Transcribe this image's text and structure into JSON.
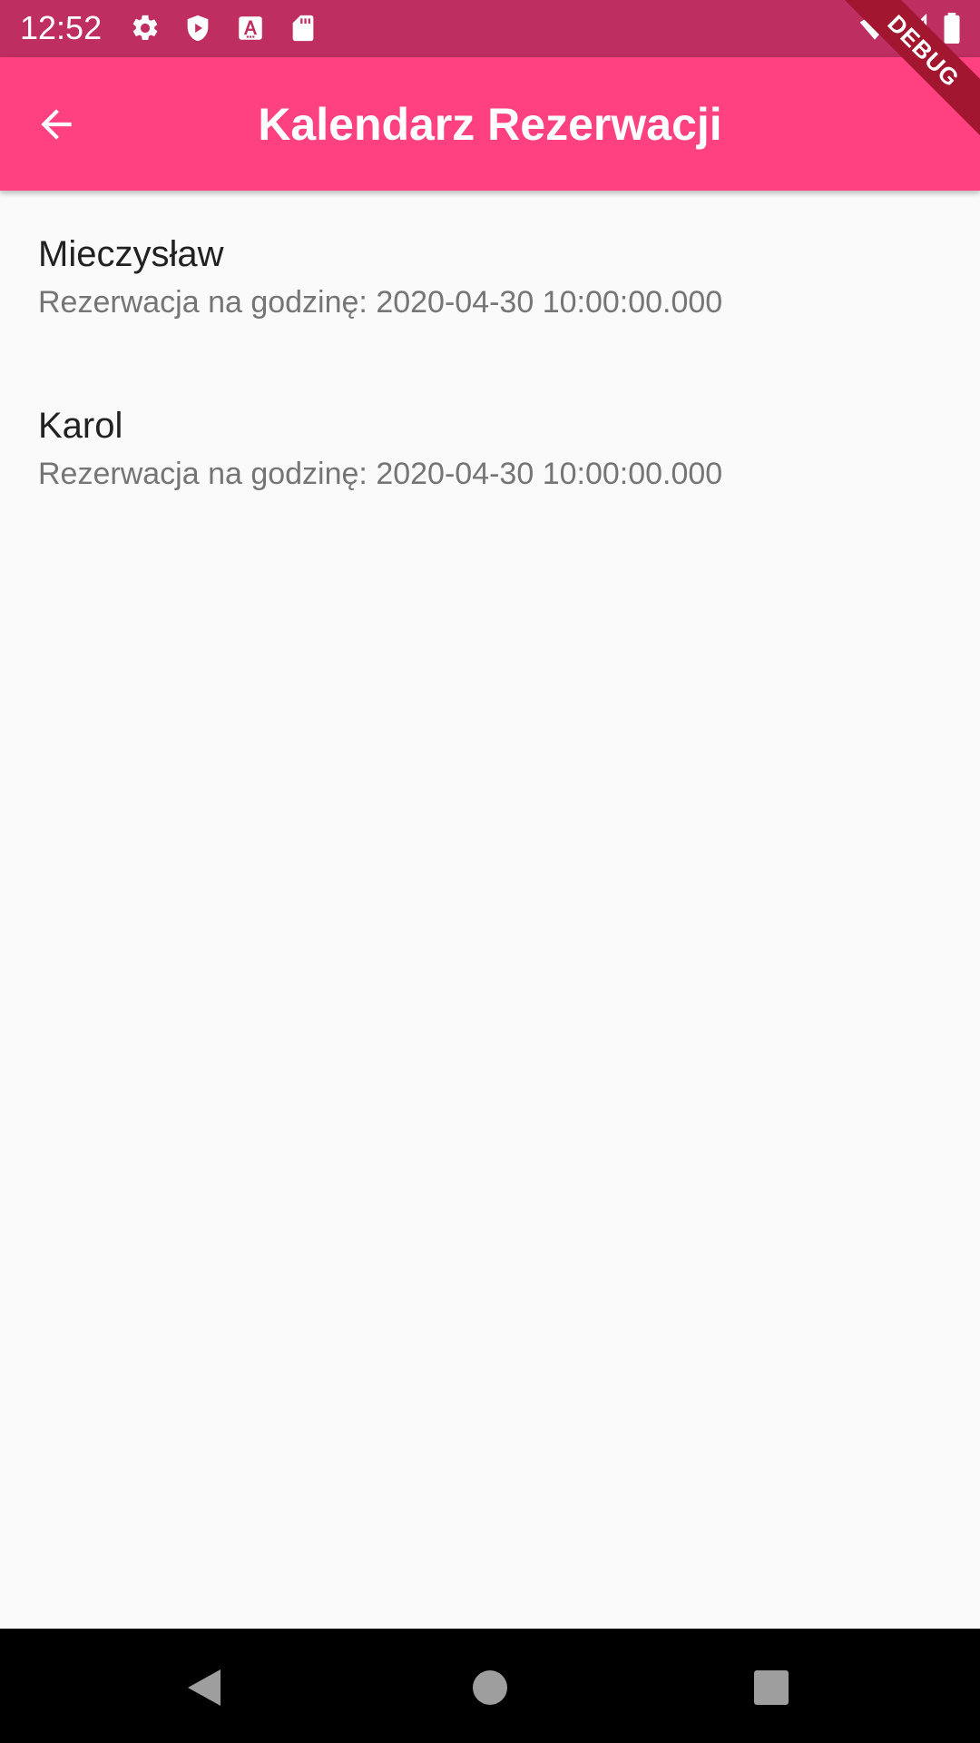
{
  "status_bar": {
    "time": "12:52",
    "left_icons": [
      "gear-icon",
      "shield-play-icon",
      "font-download-icon",
      "sd-card-icon"
    ],
    "right_icons": [
      "wifi-icon",
      "signal-icon",
      "battery-icon"
    ]
  },
  "app_bar": {
    "title": "Kalendarz Rezerwacji",
    "back_icon": "arrow-back-icon",
    "color": "#ff4081"
  },
  "debug_banner": {
    "label": "DEBUG"
  },
  "reservations": [
    {
      "name": "Mieczysław",
      "subtitle": "Rezerwacja na godzinę: 2020-04-30 10:00:00.000"
    },
    {
      "name": "Karol",
      "subtitle": "Rezerwacja na godzinę: 2020-04-30 10:00:00.000"
    }
  ],
  "nav_bar": {
    "buttons": [
      "back-triangle-icon",
      "home-circle-icon",
      "recents-square-icon"
    ]
  }
}
